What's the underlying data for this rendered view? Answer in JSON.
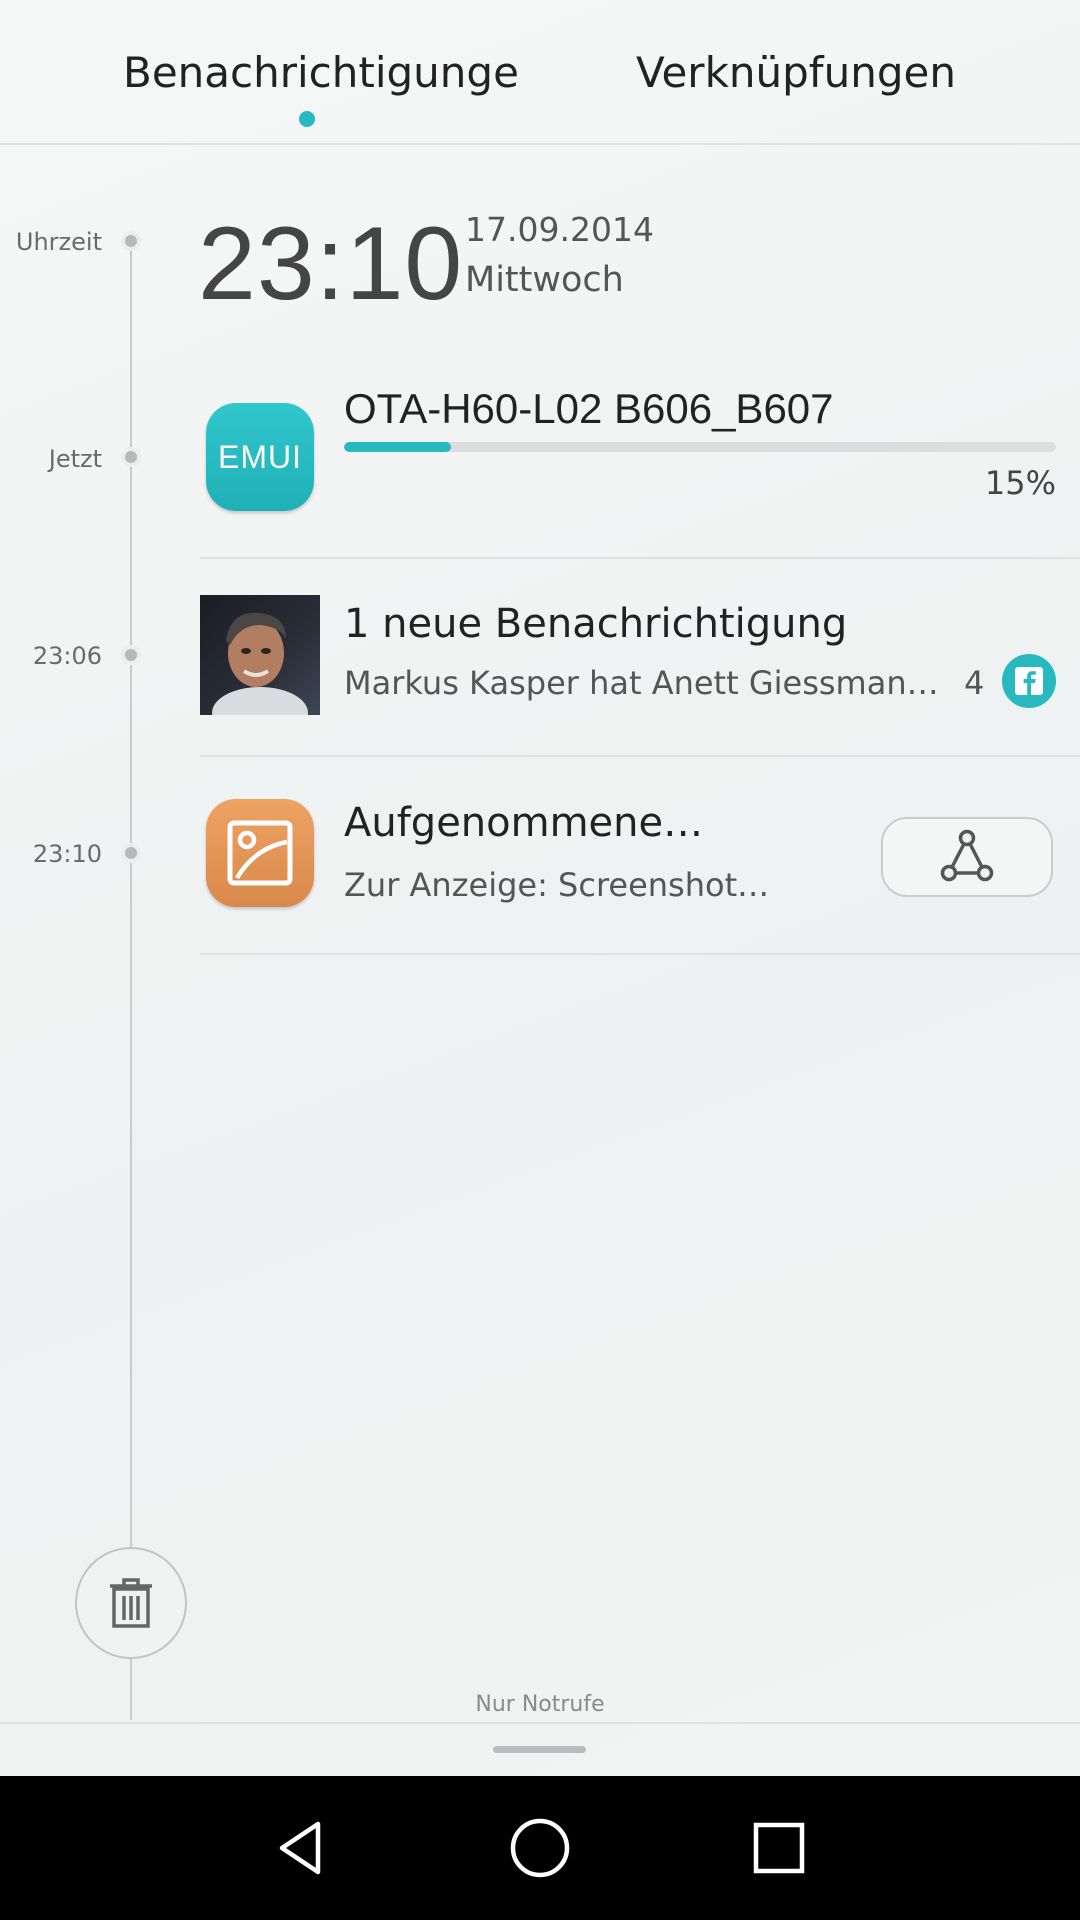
{
  "tabs": [
    {
      "label": "Benachrichtigunge",
      "active": true
    },
    {
      "label": "Verknüpfungen",
      "active": false
    }
  ],
  "accent_color": "#27b8c0",
  "timeline": {
    "labels": [
      "Uhrzeit",
      "Jetzt",
      "23:06",
      "23:10"
    ]
  },
  "clock": {
    "time": "23:10",
    "date": "17.09.2014",
    "weekday": "Mittwoch"
  },
  "notifications": {
    "ota": {
      "icon": "emui-app-icon",
      "icon_text": "EMUI",
      "title": "OTA-H60-L02 B606_B607",
      "progress": 0.15,
      "progress_label": "15%"
    },
    "facebook": {
      "icon": "contact-avatar",
      "title": "1 neue Benachrichtigung",
      "subtitle": "Markus Kasper hat Anett Giessmann V…",
      "count": "4",
      "badge_icon": "facebook-icon"
    },
    "screenshot": {
      "icon": "gallery-icon",
      "title": "Aufgenommene…",
      "subtitle": "Zur Anzeige: Screenshot…",
      "action_icon": "share-icon"
    }
  },
  "footer": {
    "clear_icon": "trash-icon",
    "emergency_text": "Nur Notrufe"
  },
  "navbar": {
    "buttons": [
      "back-icon",
      "home-icon",
      "recents-icon"
    ]
  }
}
